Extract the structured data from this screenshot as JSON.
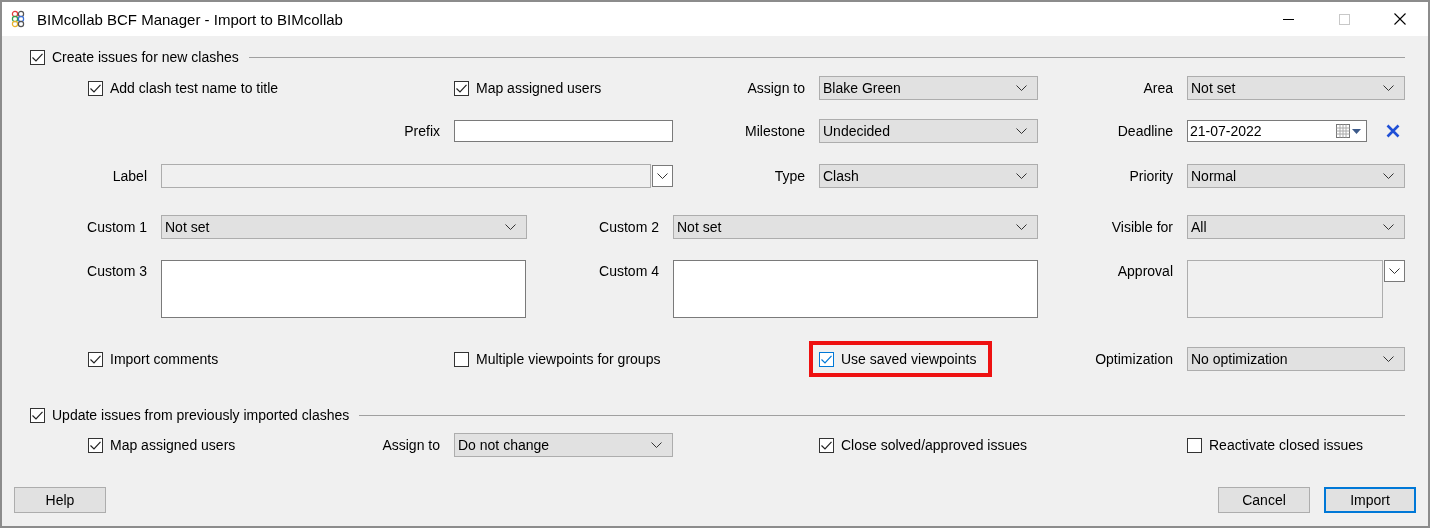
{
  "window": {
    "title": "BIMcollab BCF Manager - Import to BIMcollab"
  },
  "create_section": {
    "label": "Create issues for new clashes",
    "checked": true,
    "rows": [
      {
        "items": [
          {
            "kind": "checkbox",
            "label": "Add clash test name to title",
            "checked": true,
            "highlighted": false
          },
          {
            "kind": "checkbox",
            "label": "Map assigned users",
            "checked": true,
            "highlighted": false
          },
          {
            "kind": "label",
            "text": "Assign to"
          },
          {
            "kind": "dropdown",
            "value": "Blake Green"
          },
          {
            "kind": "label",
            "text": "Area"
          },
          {
            "kind": "dropdown",
            "value": "Not set"
          }
        ]
      },
      {
        "items": [
          {
            "kind": "label",
            "text": "Prefix"
          },
          {
            "kind": "input"
          },
          {
            "kind": "label",
            "text": "Milestone"
          },
          {
            "kind": "dropdown",
            "value": "Undecided"
          },
          {
            "kind": "label",
            "text": "Deadline"
          },
          {
            "kind": "date",
            "value": "21-07-2022"
          }
        ]
      },
      {
        "items": [
          {
            "kind": "label",
            "text": "Label"
          },
          {
            "kind": "combo"
          },
          {
            "kind": "label",
            "text": "Type"
          },
          {
            "kind": "dropdown",
            "value": "Clash"
          },
          {
            "kind": "label",
            "text": "Priority"
          },
          {
            "kind": "dropdown",
            "value": "Normal"
          }
        ]
      },
      {
        "items": [
          {
            "kind": "label",
            "text": "Custom 1"
          },
          {
            "kind": "dropdown",
            "value": "Not set"
          },
          {
            "kind": "label",
            "text": "Custom 2"
          },
          {
            "kind": "dropdown",
            "value": "Not set"
          },
          {
            "kind": "label",
            "text": "Visible for"
          },
          {
            "kind": "dropdown",
            "value": "All"
          }
        ]
      },
      {
        "items": [
          {
            "kind": "label",
            "text": "Custom 3"
          },
          {
            "kind": "textarea"
          },
          {
            "kind": "label",
            "text": "Custom 4"
          },
          {
            "kind": "textarea"
          },
          {
            "kind": "label",
            "text": "Approval"
          },
          {
            "kind": "listcombo"
          }
        ]
      },
      {
        "items": [
          {
            "kind": "checkbox",
            "label": "Import comments",
            "checked": true,
            "highlighted": false
          },
          {
            "kind": "checkbox",
            "label": "Multiple viewpoints for groups",
            "checked": false,
            "highlighted": false
          },
          {
            "kind": "checkbox",
            "label": "Use saved viewpoints",
            "checked": true,
            "highlighted": true
          },
          {
            "kind": "label",
            "text": "Optimization"
          },
          {
            "kind": "dropdown",
            "value": "No optimization"
          }
        ]
      }
    ]
  },
  "update_section": {
    "label": "Update issues from previously imported clashes",
    "checked": true,
    "rows": [
      {
        "items": [
          {
            "kind": "checkbox",
            "label": "Map assigned users",
            "checked": true,
            "highlighted": false
          },
          {
            "kind": "label",
            "text": "Assign to"
          },
          {
            "kind": "dropdown",
            "value": "Do not change"
          },
          {
            "kind": "checkbox",
            "label": "Close solved/approved issues",
            "checked": true,
            "highlighted": false
          },
          {
            "kind": "checkbox",
            "label": "Reactivate closed issues",
            "checked": false,
            "highlighted": false
          }
        ]
      }
    ]
  },
  "buttons": [
    {
      "label": "Help",
      "default": false
    },
    {
      "label": "Cancel",
      "default": false
    },
    {
      "label": "Import",
      "default": true
    }
  ]
}
